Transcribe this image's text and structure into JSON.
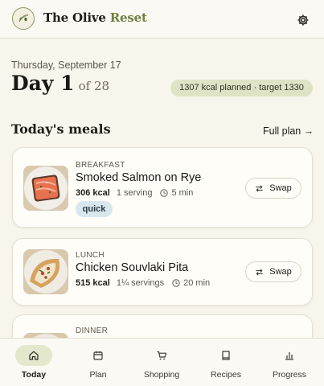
{
  "app": {
    "brand_main": "The Olive ",
    "brand_accent": "Reset",
    "logo_text": "The Olive Reset"
  },
  "header_icons": {
    "settings": "gear-icon"
  },
  "day": {
    "date": "Thursday, September 17",
    "day_label": "Day 1",
    "of_label": "of 28",
    "kcal_summary": "1307 kcal planned · target 1330"
  },
  "meals_section": {
    "title": "Today's meals",
    "full_plan_label": "Full plan →"
  },
  "meals": [
    {
      "type": "BREAKFAST",
      "name": "Smoked Salmon on Rye",
      "kcal": "306 kcal",
      "servings": "1 serving",
      "time": "5 min",
      "tag": "quick",
      "swap_label": "Swap"
    },
    {
      "type": "LUNCH",
      "name": "Chicken Souvlaki Pita",
      "kcal": "515 kcal",
      "servings": "1¼ servings",
      "time": "20 min",
      "swap_label": "Swap"
    },
    {
      "type": "DINNER"
    }
  ],
  "tabs": [
    {
      "label": "Today",
      "icon": "home-icon",
      "active": true
    },
    {
      "label": "Plan",
      "icon": "calendar-icon",
      "active": false
    },
    {
      "label": "Shopping",
      "icon": "cart-icon",
      "active": false
    },
    {
      "label": "Recipes",
      "icon": "book-icon",
      "active": false
    },
    {
      "label": "Progress",
      "icon": "bar-chart-icon",
      "active": false
    }
  ],
  "colors": {
    "background": "#f8f5ec",
    "accent": "#6f7f3f",
    "pill": "#dfe3c5",
    "tag": "#d8e6ee"
  }
}
